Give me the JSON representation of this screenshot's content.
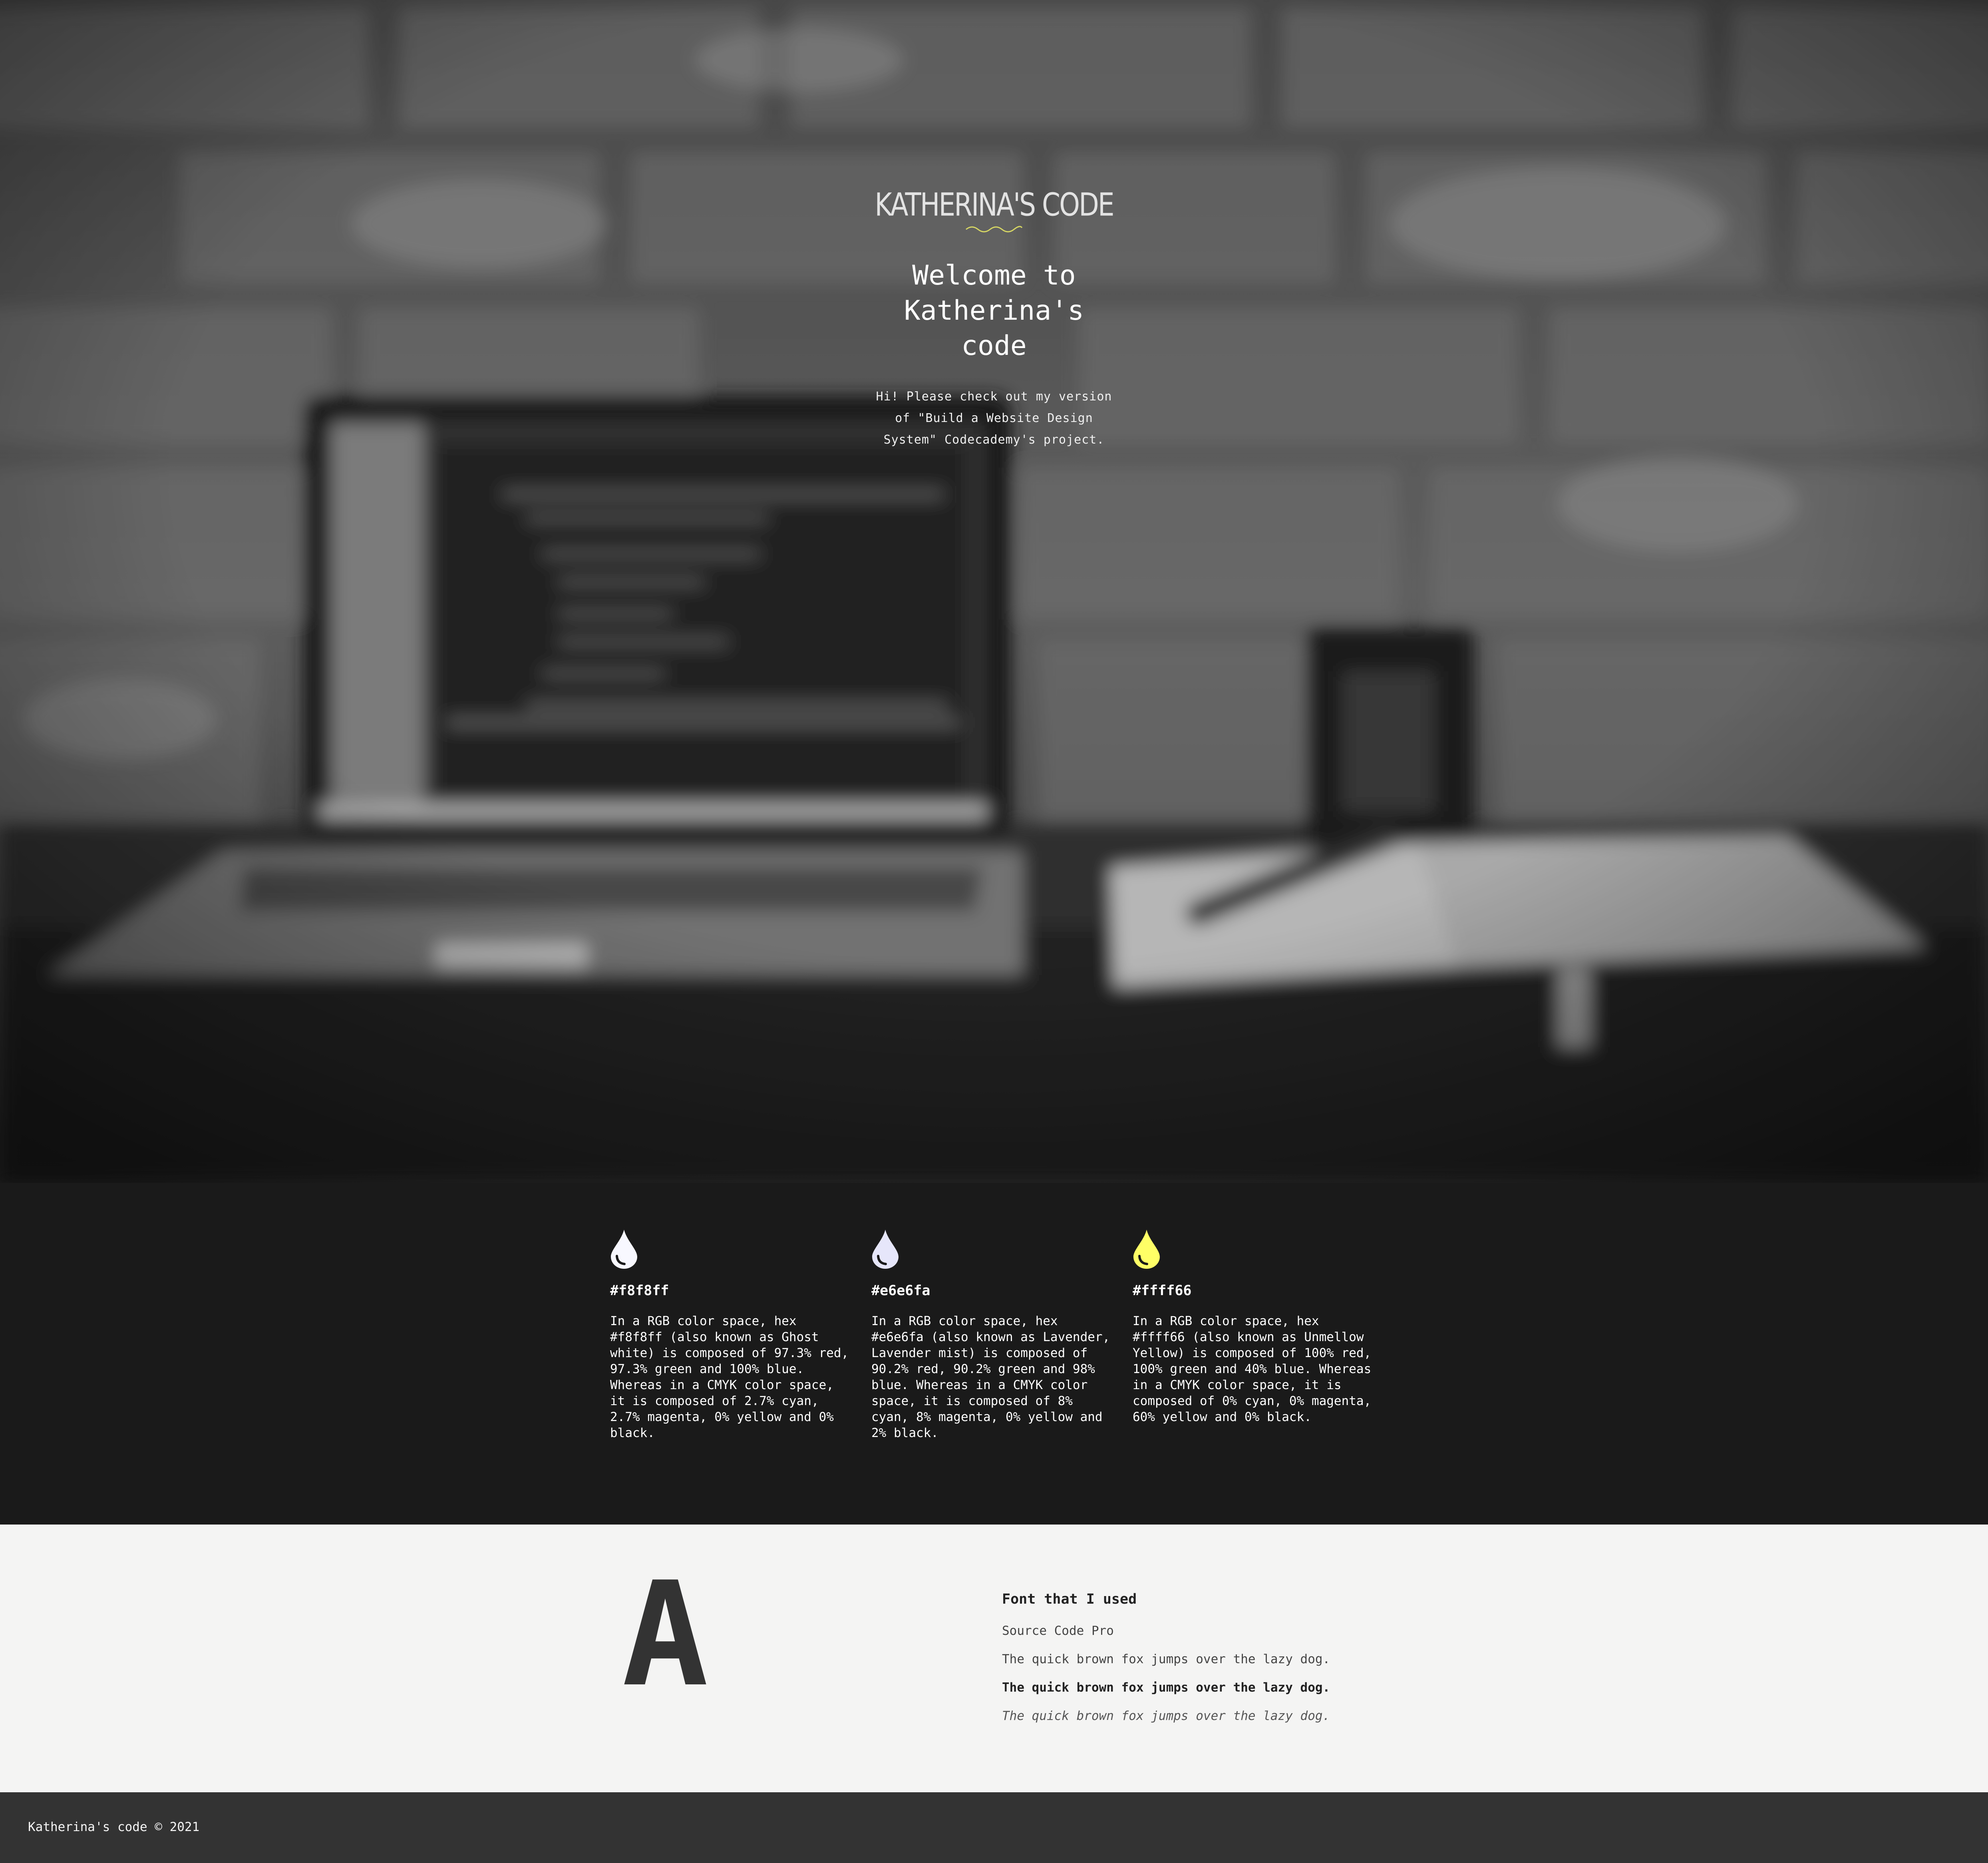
{
  "hero": {
    "logo": "KATHERINA'S CODE",
    "title": "Welcome to Katherina's code",
    "text": "Hi! Please check out my version of \"Build a Website Design System\" Codecademy's project."
  },
  "colors": [
    {
      "hex": "#f8f8ff",
      "color": "#f8f8ff",
      "description": "In a RGB color space, hex #f8f8ff (also known as Ghost white) is composed of 97.3% red, 97.3% green and 100% blue. Whereas in a CMYK color space, it is composed of 2.7% cyan, 2.7% magenta, 0% yellow and 0% black.",
      "icon": "drop-icon"
    },
    {
      "hex": "#e6e6fa",
      "color": "#e6e6fa",
      "description": "In a RGB color space, hex #e6e6fa (also known as Lavender, Lavender mist) is composed of 90.2% red, 90.2% green and 98% blue. Whereas in a CMYK color space, it is composed of 8% cyan, 8% magenta, 0% yellow and 2% black.",
      "icon": "drop-icon"
    },
    {
      "hex": "#ffff66",
      "color": "#ffff66",
      "description": "In a RGB color space, hex #ffff66 (also known as Unmellow Yellow) is composed of 100% red, 100% green and 40% blue. Whereas in a CMYK color space, it is composed of 0% cyan, 0% magenta, 60% yellow and 0% black.",
      "icon": "drop-icon"
    }
  ],
  "fonts": {
    "glyph": "A",
    "heading": "Font that I used",
    "font_name": "Source Code Pro",
    "sample_regular": "The quick brown fox jumps over the lazy dog.",
    "sample_bold": "The quick brown fox jumps over the lazy dog.",
    "sample_italic": "The quick brown fox jumps over the lazy dog."
  },
  "footer": {
    "text": "Katherina's code © 2021"
  },
  "theme": {
    "dark": "#1a1a1a",
    "light": "#f4f4f3",
    "footer": "#333333",
    "accent_wave": "#ffff66"
  }
}
